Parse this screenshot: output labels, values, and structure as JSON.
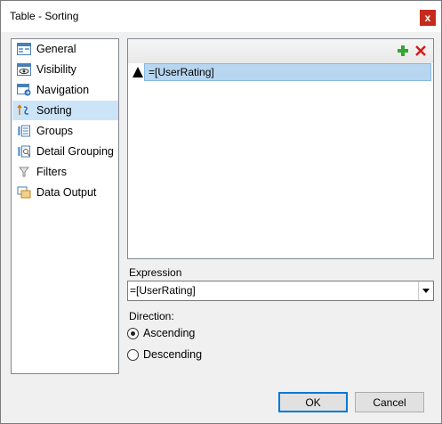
{
  "window": {
    "title": "Table - Sorting",
    "close_glyph": "x"
  },
  "nav": {
    "items": [
      {
        "label": "General",
        "icon": "general-icon",
        "selected": false
      },
      {
        "label": "Visibility",
        "icon": "visibility-icon",
        "selected": false
      },
      {
        "label": "Navigation",
        "icon": "navigation-icon",
        "selected": false
      },
      {
        "label": "Sorting",
        "icon": "sorting-icon",
        "selected": true
      },
      {
        "label": "Groups",
        "icon": "groups-icon",
        "selected": false
      },
      {
        "label": "Detail Grouping",
        "icon": "detail-grouping-icon",
        "selected": false
      },
      {
        "label": "Filters",
        "icon": "filters-icon",
        "selected": false
      },
      {
        "label": "Data Output",
        "icon": "data-output-icon",
        "selected": false
      }
    ]
  },
  "sort_list": {
    "rows": [
      {
        "direction": "ascending",
        "expression": "=[UserRating]"
      }
    ],
    "add_icon_color": "#2ea82e",
    "delete_icon_color": "#d91a1a"
  },
  "expression": {
    "label": "Expression",
    "value": "=[UserRating]"
  },
  "direction": {
    "label": "Direction:",
    "options": [
      {
        "label": "Ascending",
        "checked": true
      },
      {
        "label": "Descending",
        "checked": false
      }
    ]
  },
  "buttons": {
    "ok": "OK",
    "cancel": "Cancel"
  },
  "colors": {
    "selection": "#cce4f7",
    "row_highlight": "#b8d6f0",
    "accent": "#0078d7"
  }
}
